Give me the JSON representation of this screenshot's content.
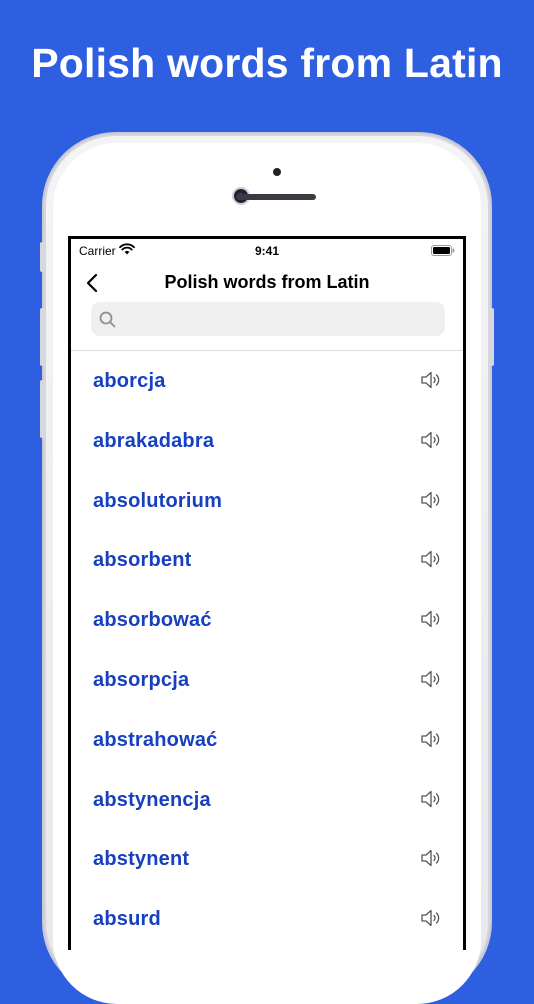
{
  "promo": {
    "title": "Polish words from Latin"
  },
  "status_bar": {
    "carrier": "Carrier",
    "time": "9:41"
  },
  "nav": {
    "title": "Polish words from Latin",
    "back_icon": "chevron-left-icon"
  },
  "search": {
    "placeholder": "",
    "value": "",
    "icon": "search-icon"
  },
  "colors": {
    "background": "#2E5FE0",
    "word": "#1740C0",
    "speaker": "#555555"
  },
  "words": [
    {
      "label": "aborcja"
    },
    {
      "label": "abrakadabra"
    },
    {
      "label": "absolutorium"
    },
    {
      "label": "absorbent"
    },
    {
      "label": "absorbować"
    },
    {
      "label": "absorpcja"
    },
    {
      "label": "abstrahować"
    },
    {
      "label": "abstynencja"
    },
    {
      "label": "abstynent"
    },
    {
      "label": "absurd"
    }
  ]
}
